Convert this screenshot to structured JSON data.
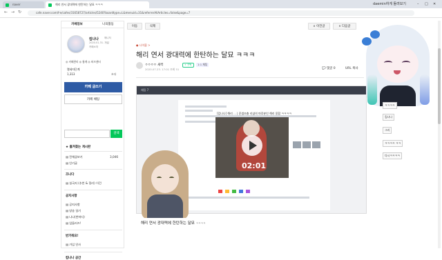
{
  "browser": {
    "tabs": [
      {
        "label": "naver"
      },
      {
        "label": "해리 연서 광대력에 한탄하는 달묘 ㅋㅋㅋ"
      }
    ],
    "right_tab": "daemin하게 돌려보기",
    "window_controls": [
      "–",
      "□",
      "✕"
    ],
    "url": "cafe.naver.com/f-e/cafes/31658727/articles/5240?boardtype=L&menuid=31&referrerAllArticles=false&page=7"
  },
  "sidebar": {
    "tabs": [
      "카페정보",
      "나의활동"
    ],
    "profile": {
      "name": "킴나나",
      "badge": "매니저",
      "date": "2020.01.31. 개설",
      "intro": "카페소개",
      "links": "◎ 카페관리   ◎ 통계   ◎ 비즈센터"
    },
    "grade": "열세자단계",
    "members": "1,313",
    "invite": "초대",
    "write_button": "카페 글쓰기",
    "chat_button": "카페 채팅",
    "search_button": "검색",
    "favorites_header": "★ 즐겨찾는 게시판",
    "menu": [
      {
        "label": "▤ 전체글보기",
        "count": "3,046"
      },
      {
        "label": "▤ 인기글",
        "count": ""
      }
    ],
    "section_notice": "즈나다",
    "section_notice_item": "▤ 실국지 (추천 & 정리) 이건",
    "section_announce": "공지사항",
    "announce_items": [
      "▤ 공지사항",
      "▤ 방송 일기",
      "▤ 나나(한마디)",
      "▤ 업들러즈!"
    ],
    "section_welcome": "반가워요!",
    "welcome_item": "▤ 가입 인사",
    "section_space": "킴나나 공간"
  },
  "toolbar": {
    "edit": "이동",
    "delete": "삭제",
    "prev": "∧ 이전글",
    "next": "∨ 다음글",
    "list": "목록"
  },
  "post": {
    "category": "● 나이볼 >",
    "title": "해리 연서 광대력에 한탄하는 달묘 ㅋㅋㅋ",
    "author": "ㅇㅇㅇㅇ 새싹",
    "author_badge": "+ 구독",
    "author_grade": "1:1 채팅",
    "date": "2020.07.23. 17:01  조회 51",
    "comment": "💬 댓글 0",
    "url_copy": "URL 복사",
    "shot_top": "채팅 7",
    "shot_title": "[킴나나] 해리 ... | 준썸조충 리샵의 마루분인 해리 옹합 ㅋㅋㅋㅋ",
    "video_time": "02:01",
    "caption": "해리 연서 광대력에 한탄하는 달묘",
    "caption_small": "ㅋㅋㅋㅋ"
  },
  "right_column": [
    "ㅋㅋㅋㅋ",
    "킴나나",
    "그리",
    "ㅋㅋㅋㅋ ㅋㅋ",
    "다시ㅋㅋㅋㅋ"
  ],
  "colors": {
    "accent": "#2e5ba5",
    "naver_green": "#03c75a"
  }
}
